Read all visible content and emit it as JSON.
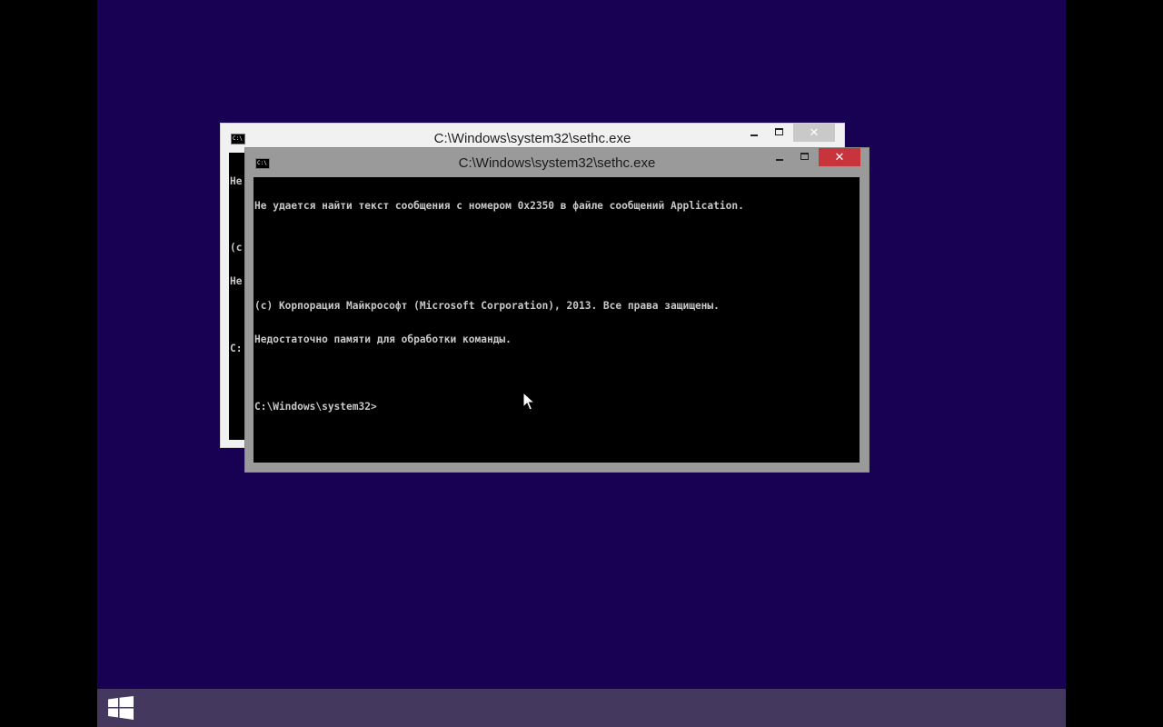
{
  "desktop": {
    "background_color": "#180052",
    "pointer": "arrow-cursor-icon"
  },
  "back_window": {
    "title": "C:\\Windows\\system32\\sethc.exe",
    "icon": "console-icon",
    "controls": {
      "minimize": "minimize",
      "maximize": "maximize",
      "close": "✕"
    },
    "console_lines": [
      "Не",
      "",
      "(c",
      "Не",
      "",
      "C:"
    ]
  },
  "front_window": {
    "title": "C:\\Windows\\system32\\sethc.exe",
    "icon": "console-icon",
    "controls": {
      "minimize": "minimize",
      "maximize": "maximize",
      "close": "✕"
    },
    "close_color": "#c7343b",
    "console_lines": [
      "Не удается найти текст сообщения с номером 0x2350 в файле сообщений Application.",
      "",
      "",
      "(c) Корпорация Майкрософт (Microsoft Corporation), 2013. Все права защищены.",
      "Недостаточно памяти для обработки команды.",
      "",
      "C:\\Windows\\system32>"
    ]
  },
  "taskbar": {
    "color": "#45385f",
    "start_icon": "windows-logo-icon"
  }
}
